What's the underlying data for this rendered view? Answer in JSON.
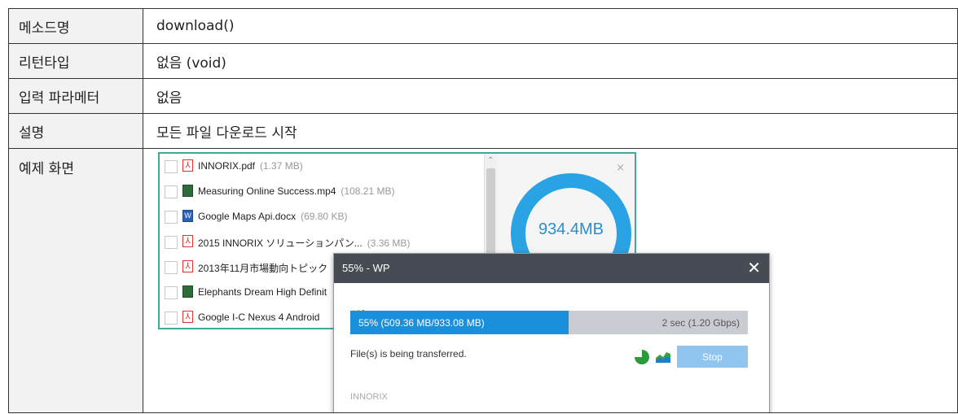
{
  "rows": [
    {
      "label": "메소드명",
      "value": "download()"
    },
    {
      "label": "리턴타입",
      "value": "없음 (void)"
    },
    {
      "label": "입력 파라메터",
      "value": "없음"
    },
    {
      "label": "설명",
      "value": "모든 파일 다운로드 시작"
    },
    {
      "label": "예제 화면",
      "value": ""
    }
  ],
  "files": [
    {
      "name": "INNORIX.pdf",
      "size": "(1.37 MB)",
      "icon": "pdf-icon"
    },
    {
      "name": "Measuring Online Success.mp4",
      "size": "(108.21 MB)",
      "icon": "video-icon"
    },
    {
      "name": "Google Maps Api.docx",
      "size": "(69.80 KB)",
      "icon": "doc-icon"
    },
    {
      "name": "2015 INNORIX ソリューションパン...",
      "size": "(3.36 MB)",
      "icon": "pdf-icon"
    },
    {
      "name": "2013年11月市場動向トピック",
      "size": "",
      "icon": "pdf-icon"
    },
    {
      "name": "Elephants Dream High Definit",
      "size": "",
      "icon": "video-icon"
    },
    {
      "name": "Google I-C Nexus 4 Android",
      "size": "",
      "icon": "pdf-icon"
    }
  ],
  "total_size": "934.4MB",
  "panel_close": "×",
  "dialog": {
    "title": "55% - WP",
    "close": "✕",
    "progress_percent": 55,
    "progress_text": "55% (509.36 MB/933.08 MB)",
    "rate_text": "2 sec (1.20 Gbps)",
    "status": "File(s) is being transferred.",
    "stop_label": "Stop",
    "brand": "INNORIX",
    "dot_colors": [
      "#cccccc",
      "#f2b31b",
      "#4aa845"
    ]
  }
}
